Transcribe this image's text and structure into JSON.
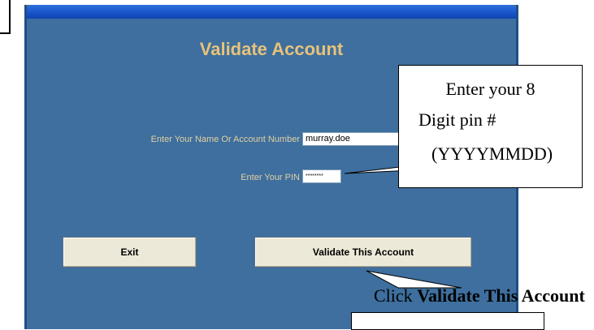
{
  "window": {
    "title": "Validate Account",
    "name_label": "Enter Your Name Or Account Number",
    "name_value": "murray.doe",
    "pin_label": "Enter Your PIN",
    "pin_value": "********",
    "exit_label": "Exit",
    "validate_label": "Validate This Account"
  },
  "callouts": {
    "pin_line1": "Enter your 8",
    "pin_line2": "Digit pin #",
    "pin_line3": "(YYYYMMDD)",
    "click_prefix": "Click ",
    "click_bold": "Validate This Account"
  },
  "colors": {
    "window_bg": "#3e6f9e",
    "title": "#e8c27a",
    "label": "#e2cfa1",
    "button": "#ece9d8"
  }
}
